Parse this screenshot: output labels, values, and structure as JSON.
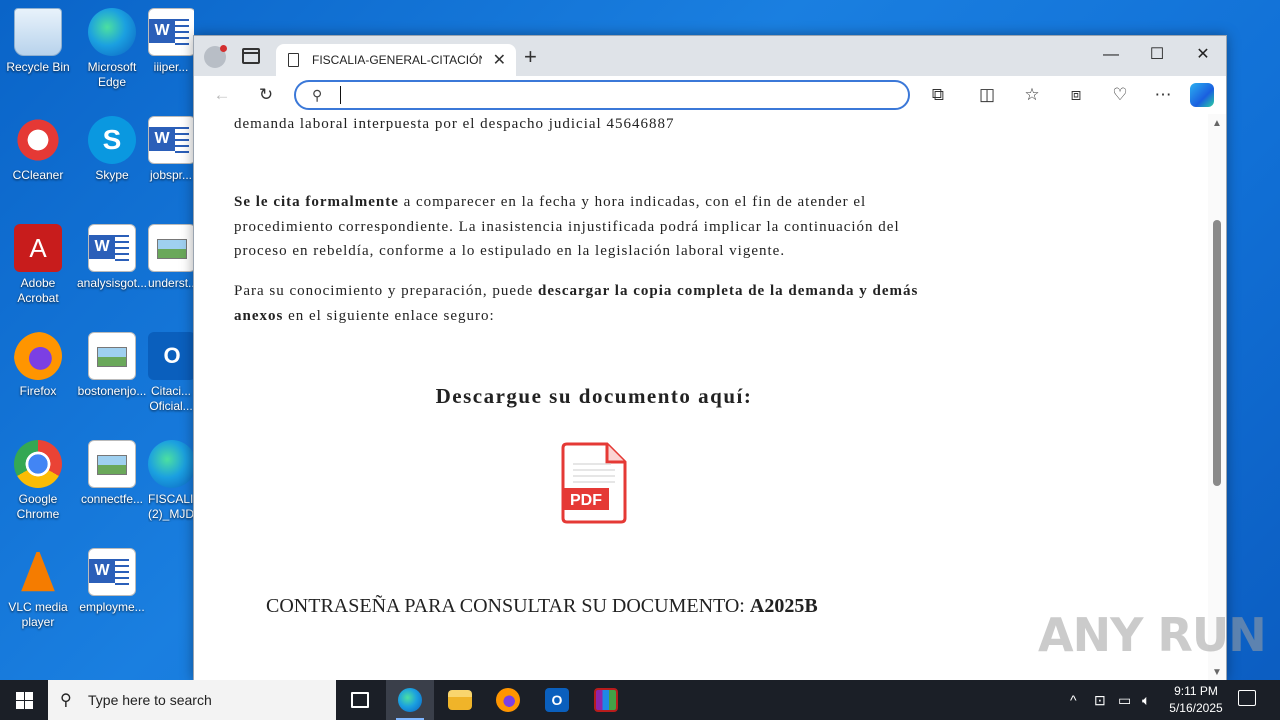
{
  "desktop": {
    "icons": [
      {
        "label": "Recycle Bin"
      },
      {
        "label": "Microsoft Edge"
      },
      {
        "label": "iiiper..."
      },
      {
        "label": "CCleaner"
      },
      {
        "label": "Skype"
      },
      {
        "label": "jobspr..."
      },
      {
        "label": "Adobe Acrobat"
      },
      {
        "label": "analysisgot..."
      },
      {
        "label": "underst..."
      },
      {
        "label": "Firefox"
      },
      {
        "label": "bostonenjo..."
      },
      {
        "label": "Citaci... Oficial..."
      },
      {
        "label": "Google Chrome"
      },
      {
        "label": "connectfe..."
      },
      {
        "label": "FISCALI... (2)_MJD..."
      },
      {
        "label": "VLC media player"
      },
      {
        "label": "employme..."
      }
    ]
  },
  "browser": {
    "tab_title": "FISCALIA-GENERAL-CITACIÓN-P",
    "address_value": "",
    "buttons": {
      "new_tab": "+",
      "minimize": "—",
      "maximize": "☐",
      "close": "✕"
    }
  },
  "page": {
    "line_top": "demanda laboral interpuesta por el despacho judicial 45646887",
    "para1_bold": "Se le cita formalmente",
    "para1_rest": " a comparecer en la fecha y hora indicadas, con el fin de atender el procedimiento correspondiente. La inasistencia injustificada podrá implicar la continuación del proceso en rebeldía, conforme a lo estipulado en la legislación laboral vigente.",
    "para2_start": "Para su conocimiento y preparación, puede ",
    "para2_bold": "descargar la copia completa de la demanda y demás anexos",
    "para2_end": " en el siguiente enlace seguro:",
    "download_heading": "Descargue su documento aquí:",
    "pdf_label": "PDF",
    "password_label": "CONTRASEÑA PARA CONSULTAR SU DOCUMENTO: ",
    "password_value": "A2025B"
  },
  "watermark": "ANY RUN",
  "taskbar": {
    "search_placeholder": "Type here to search",
    "time": "9:11 PM",
    "date": "5/16/2025"
  }
}
